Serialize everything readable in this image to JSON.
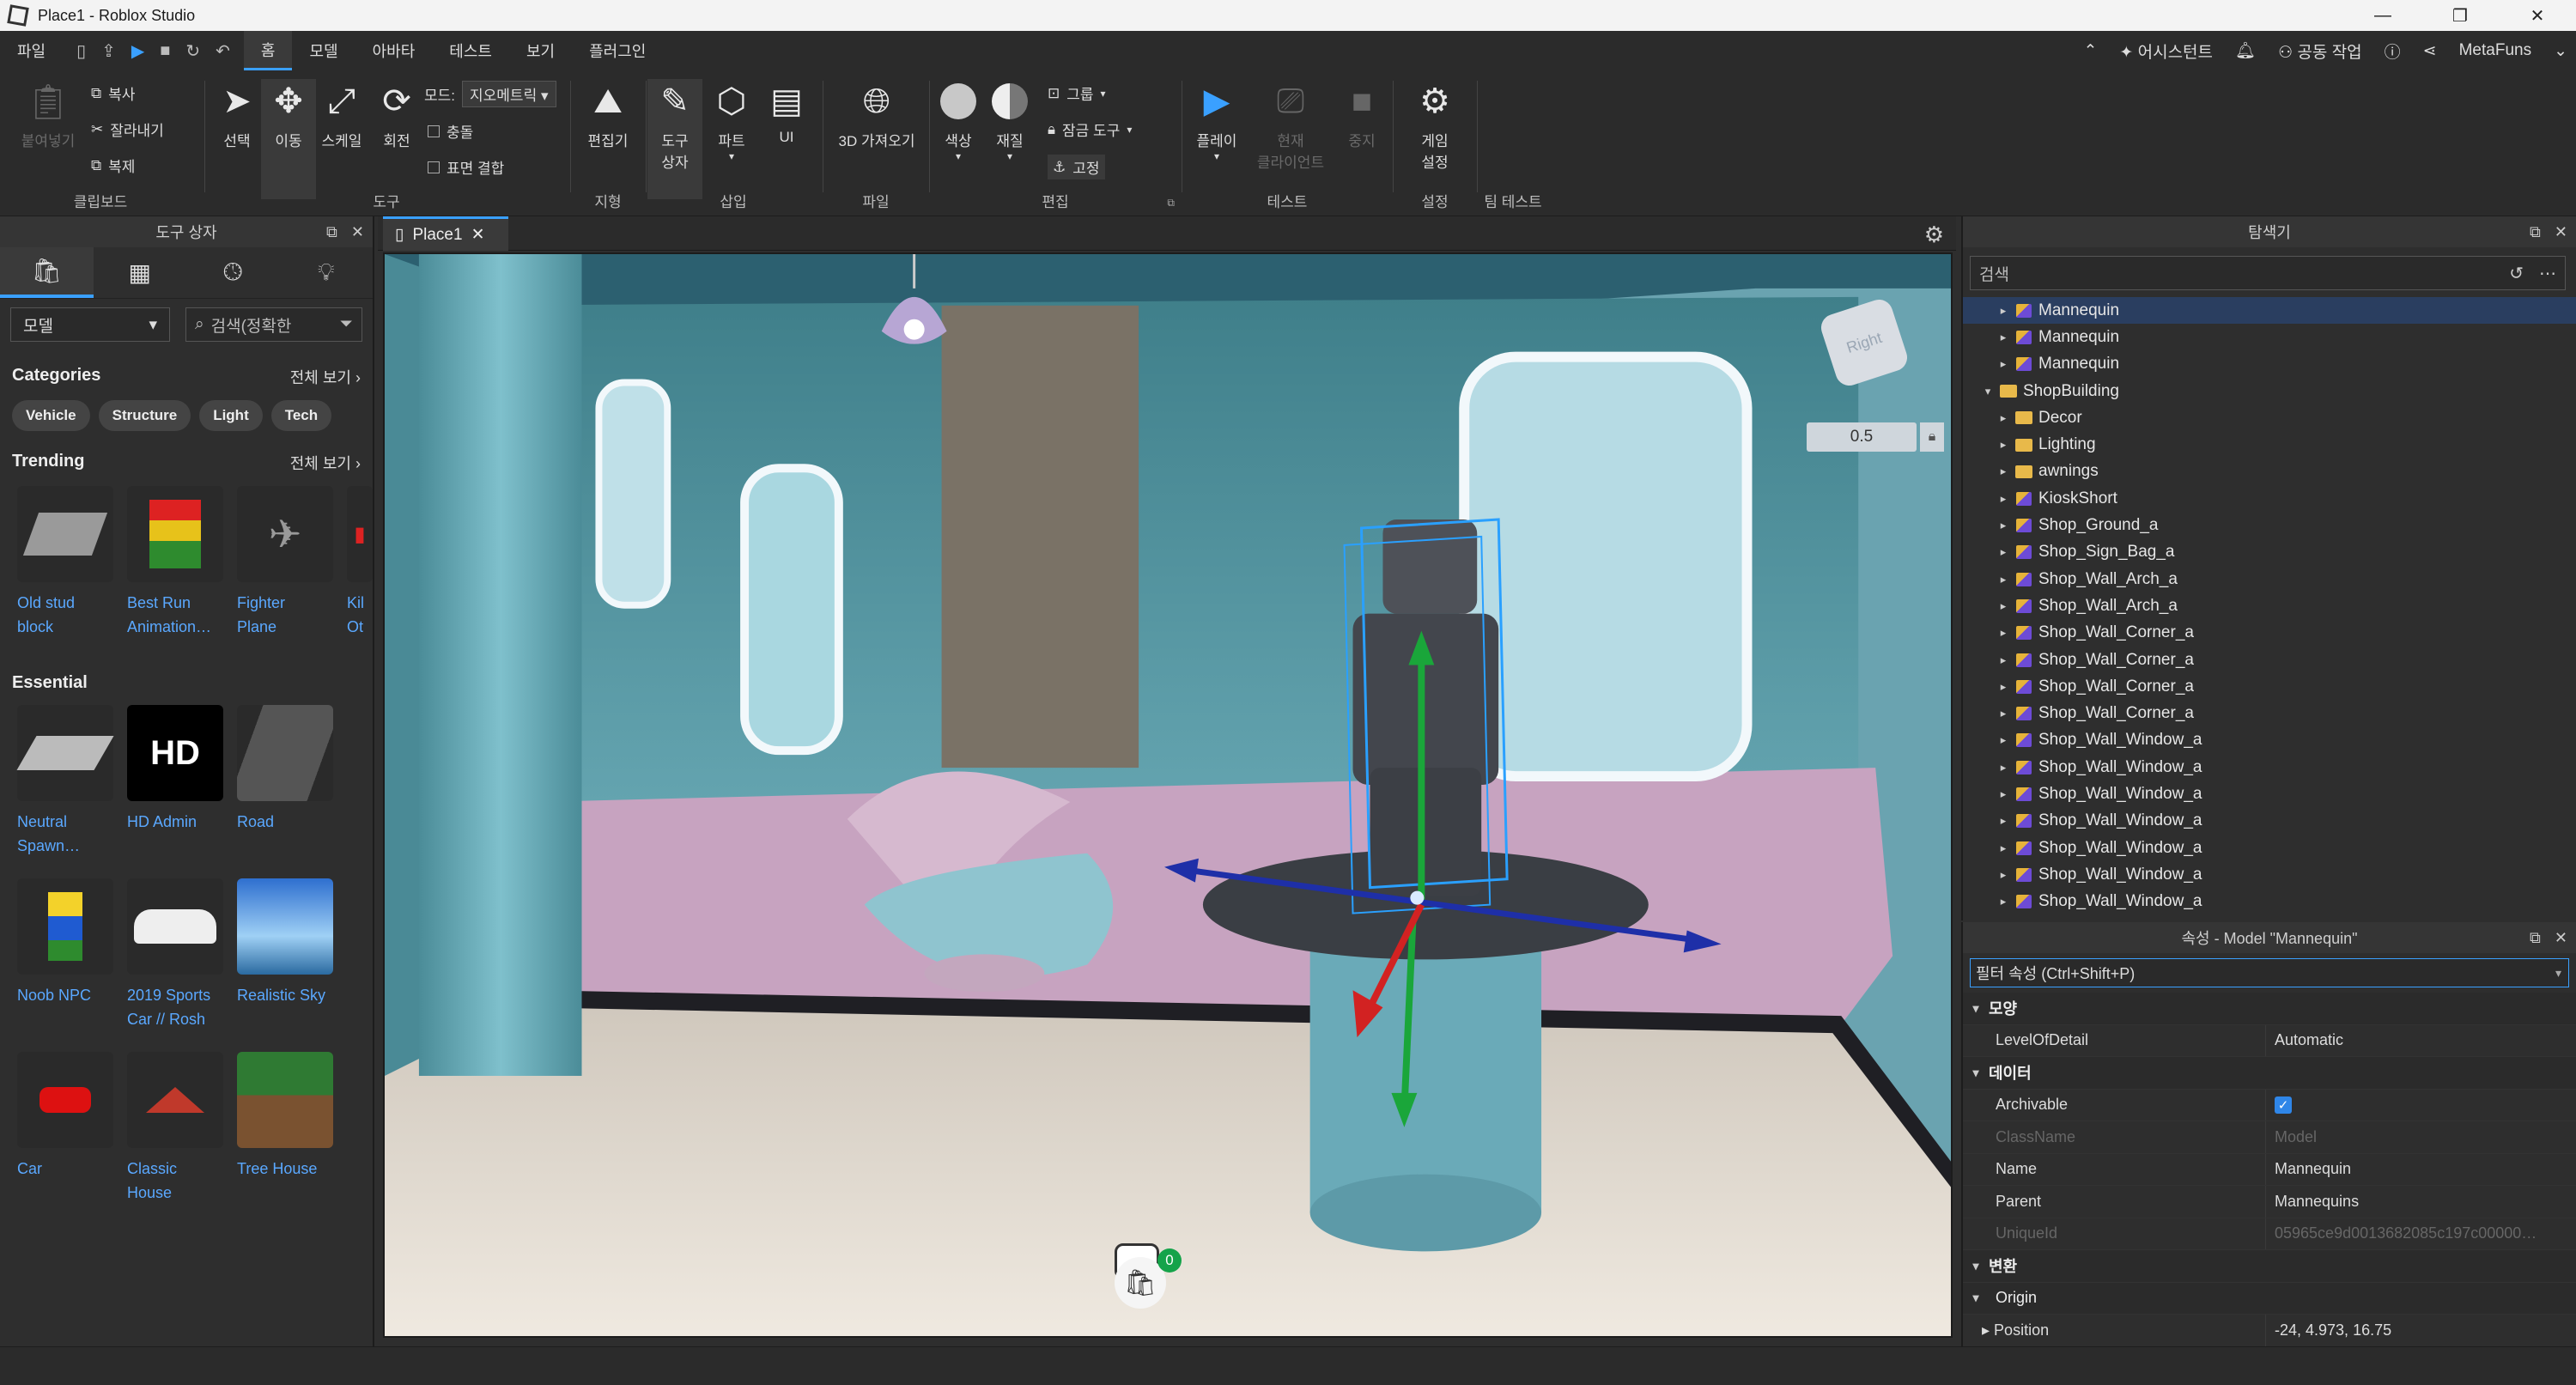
{
  "window": {
    "title": "Place1 - Roblox Studio",
    "buttons": [
      "—",
      "❐",
      "✕"
    ]
  },
  "menubar": {
    "items": [
      "파일",
      "홈",
      "모델",
      "아바타",
      "테스트",
      "보기",
      "플러그인"
    ],
    "active": "홈",
    "right": {
      "asset_manager": "어시스턴트",
      "collab": "공동 작업",
      "user": "MetaFuns"
    }
  },
  "ribbon": {
    "clipboard": {
      "paste": "붙여넣기",
      "copy": "복사",
      "cut": "잘라내기",
      "duplicate": "복제",
      "group_label": "클립보드"
    },
    "tools": {
      "select": "선택",
      "move": "이동",
      "scale": "스케일",
      "rotate": "회전",
      "mode_label": "모드:",
      "mode_value": "지오메트릭",
      "collisions": "충돌",
      "join_surfaces": "표면 결합",
      "group_label": "도구"
    },
    "terrain": {
      "editor": "편집기",
      "group_label": "지형"
    },
    "insert": {
      "toolbox": "도구\n상자",
      "toolbox_line1": "도구",
      "toolbox_line2": "상자",
      "part": "파트",
      "ui": "UI",
      "group_label": "삽입"
    },
    "file": {
      "import3d": "3D 가져오기",
      "group_label": "파일"
    },
    "edit": {
      "color": "색상",
      "material": "재질",
      "group": "그룹",
      "lock": "잠금 도구",
      "anchor": "고정",
      "group_label": "편집"
    },
    "test": {
      "play": "플레이",
      "current_client_line1": "현재",
      "current_client_line2": "클라이언트",
      "stop": "중지",
      "group_label": "테스트"
    },
    "settings": {
      "game_settings_line1": "게임",
      "game_settings_line2": "설정",
      "group_label": "설정"
    },
    "team_test": {
      "group_label": "팀 테스트"
    }
  },
  "toolbox": {
    "title": "도구 상자",
    "tabs": [
      "bag-icon",
      "grid-icon",
      "clock-icon",
      "bulb-icon"
    ],
    "category_dropdown": "모델",
    "search_placeholder": "검색(정확한",
    "categories_title": "Categories",
    "see_all": "전체 보기",
    "chips": [
      "Vehicle",
      "Structure",
      "Light",
      "Tech"
    ],
    "trending_title": "Trending",
    "trending": [
      {
        "line1": "Old stud",
        "line2": "block"
      },
      {
        "line1": "Best Run",
        "line2": "Animation…"
      },
      {
        "line1": "Fighter",
        "line2": "Plane"
      },
      {
        "line1": "Kil",
        "line2": "Ot"
      }
    ],
    "essential_title": "Essential",
    "essential_rows": [
      [
        {
          "line1": "Neutral",
          "line2": "Spawn…"
        },
        {
          "line1": "HD Admin",
          "line2": ""
        },
        {
          "line1": "Road",
          "line2": ""
        }
      ],
      [
        {
          "line1": "Noob NPC",
          "line2": ""
        },
        {
          "line1": "2019 Sports",
          "line2": "Car // Rosh"
        },
        {
          "line1": "Realistic Sky",
          "line2": ""
        }
      ],
      [
        {
          "line1": "Car",
          "line2": ""
        },
        {
          "line1": "Classic",
          "line2": "House"
        },
        {
          "line1": "Tree House",
          "line2": ""
        }
      ]
    ],
    "hd_label": "HD"
  },
  "viewport": {
    "tab": "Place1",
    "viewcube_label": "Right",
    "zoom_value": "0.5",
    "bag_count": "0"
  },
  "explorer": {
    "title": "탐색기",
    "search_placeholder": "검색",
    "items": [
      {
        "label": "Mannequin",
        "type": "model",
        "indent": 2,
        "arrow": "▸",
        "selected": true
      },
      {
        "label": "Mannequin",
        "type": "model",
        "indent": 2,
        "arrow": "▸"
      },
      {
        "label": "Mannequin",
        "type": "model",
        "indent": 2,
        "arrow": "▸"
      },
      {
        "label": "ShopBuilding",
        "type": "folder",
        "indent": 1,
        "arrow": "▾"
      },
      {
        "label": "Decor",
        "type": "folder",
        "indent": 2,
        "arrow": "▸"
      },
      {
        "label": "Lighting",
        "type": "folder",
        "indent": 2,
        "arrow": "▸"
      },
      {
        "label": "awnings",
        "type": "folder",
        "indent": 2,
        "arrow": "▸"
      },
      {
        "label": "KioskShort",
        "type": "model",
        "indent": 2,
        "arrow": "▸"
      },
      {
        "label": "Shop_Ground_a",
        "type": "model",
        "indent": 2,
        "arrow": "▸"
      },
      {
        "label": "Shop_Sign_Bag_a",
        "type": "model",
        "indent": 2,
        "arrow": "▸"
      },
      {
        "label": "Shop_Wall_Arch_a",
        "type": "model",
        "indent": 2,
        "arrow": "▸"
      },
      {
        "label": "Shop_Wall_Arch_a",
        "type": "model",
        "indent": 2,
        "arrow": "▸"
      },
      {
        "label": "Shop_Wall_Corner_a",
        "type": "model",
        "indent": 2,
        "arrow": "▸"
      },
      {
        "label": "Shop_Wall_Corner_a",
        "type": "model",
        "indent": 2,
        "arrow": "▸"
      },
      {
        "label": "Shop_Wall_Corner_a",
        "type": "model",
        "indent": 2,
        "arrow": "▸"
      },
      {
        "label": "Shop_Wall_Corner_a",
        "type": "model",
        "indent": 2,
        "arrow": "▸"
      },
      {
        "label": "Shop_Wall_Window_a",
        "type": "model",
        "indent": 2,
        "arrow": "▸"
      },
      {
        "label": "Shop_Wall_Window_a",
        "type": "model",
        "indent": 2,
        "arrow": "▸"
      },
      {
        "label": "Shop_Wall_Window_a",
        "type": "model",
        "indent": 2,
        "arrow": "▸"
      },
      {
        "label": "Shop_Wall_Window_a",
        "type": "model",
        "indent": 2,
        "arrow": "▸"
      },
      {
        "label": "Shop_Wall_Window_a",
        "type": "model",
        "indent": 2,
        "arrow": "▸"
      },
      {
        "label": "Shop_Wall_Window_a",
        "type": "model",
        "indent": 2,
        "arrow": "▸"
      },
      {
        "label": "Shop_Wall_Window_a",
        "type": "model",
        "indent": 2,
        "arrow": "▸"
      }
    ]
  },
  "properties": {
    "title": "속성 - Model \"Mannequin\"",
    "filter_placeholder": "필터 속성 (Ctrl+Shift+P)",
    "rows": [
      {
        "kind": "cat",
        "name": "모양"
      },
      {
        "kind": "prop",
        "name": "LevelOfDetail",
        "value": "Automatic"
      },
      {
        "kind": "cat",
        "name": "데이터"
      },
      {
        "kind": "check",
        "name": "Archivable",
        "value": "✓"
      },
      {
        "kind": "dim",
        "name": "ClassName",
        "value": "Model"
      },
      {
        "kind": "prop",
        "name": "Name",
        "value": "Mannequin"
      },
      {
        "kind": "prop",
        "name": "Parent",
        "value": "Mannequins"
      },
      {
        "kind": "dim",
        "name": "UniqueId",
        "value": "05965ce9d0013682085c197c00000…"
      },
      {
        "kind": "cat",
        "name": "변환"
      },
      {
        "kind": "subcat",
        "name": "Origin"
      },
      {
        "kind": "sub",
        "name": "Position",
        "value": "-24, 4.973, 16.75"
      }
    ]
  }
}
